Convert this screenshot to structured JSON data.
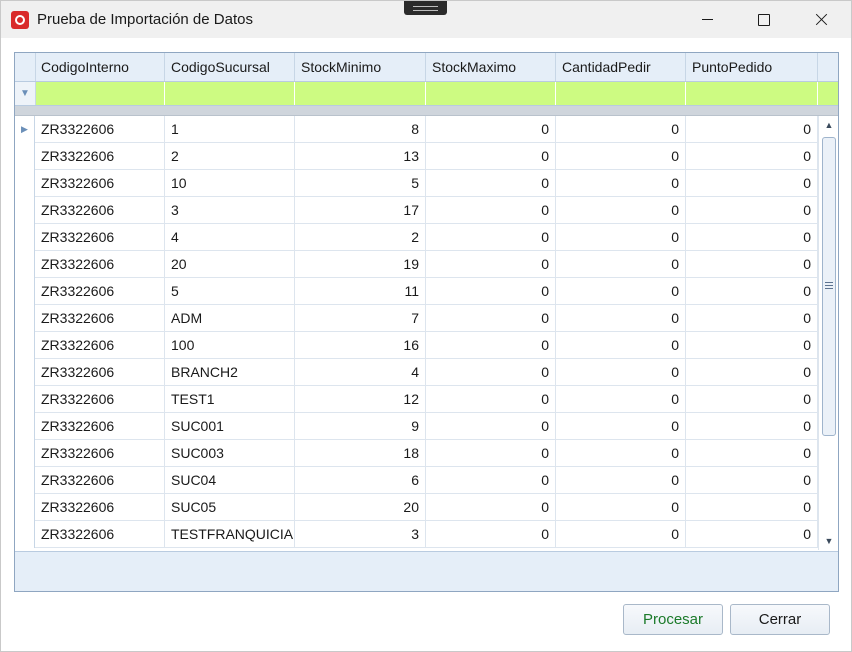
{
  "window": {
    "title": "Prueba de Importación de Datos"
  },
  "grid": {
    "columns": [
      "CodigoInterno",
      "CodigoSucursal",
      "StockMinimo",
      "StockMaximo",
      "CantidadPedir",
      "PuntoPedido"
    ],
    "rows": [
      [
        "ZR3322606",
        "1",
        "8",
        "0",
        "0",
        "0"
      ],
      [
        "ZR3322606",
        "2",
        "13",
        "0",
        "0",
        "0"
      ],
      [
        "ZR3322606",
        "10",
        "5",
        "0",
        "0",
        "0"
      ],
      [
        "ZR3322606",
        "3",
        "17",
        "0",
        "0",
        "0"
      ],
      [
        "ZR3322606",
        "4",
        "2",
        "0",
        "0",
        "0"
      ],
      [
        "ZR3322606",
        "20",
        "19",
        "0",
        "0",
        "0"
      ],
      [
        "ZR3322606",
        "5",
        "11",
        "0",
        "0",
        "0"
      ],
      [
        "ZR3322606",
        "ADM",
        "7",
        "0",
        "0",
        "0"
      ],
      [
        "ZR3322606",
        "100",
        "16",
        "0",
        "0",
        "0"
      ],
      [
        "ZR3322606",
        "BRANCH2",
        "4",
        "0",
        "0",
        "0"
      ],
      [
        "ZR3322606",
        "TEST1",
        "12",
        "0",
        "0",
        "0"
      ],
      [
        "ZR3322606",
        "SUC001",
        "9",
        "0",
        "0",
        "0"
      ],
      [
        "ZR3322606",
        "SUC003",
        "18",
        "0",
        "0",
        "0"
      ],
      [
        "ZR3322606",
        "SUC04",
        "6",
        "0",
        "0",
        "0"
      ],
      [
        "ZR3322606",
        "SUC05",
        "20",
        "0",
        "0",
        "0"
      ],
      [
        "ZR3322606",
        "TESTFRANQUICIA",
        "3",
        "0",
        "0",
        "0"
      ]
    ],
    "filter_row_color": "#cdfb82"
  },
  "buttons": {
    "procesar": "Procesar",
    "cerrar": "Cerrar"
  }
}
